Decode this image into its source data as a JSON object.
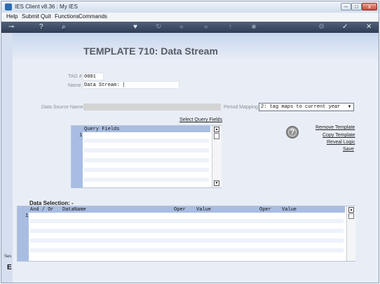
{
  "window": {
    "title": "IES Client v8.36 : My IES",
    "buttons": {
      "minimize": "–",
      "maximize": "□",
      "close": "x"
    }
  },
  "menu": [
    "Help",
    "Submit",
    "Quit",
    "Functions",
    "Commands"
  ],
  "toolbar": {
    "icons": [
      {
        "name": "key-icon",
        "glyph": "⊸"
      },
      {
        "name": "help-circle-icon",
        "glyph": "?"
      },
      {
        "name": "search-icon",
        "glyph": "⌕"
      },
      {
        "name": "heart-icon",
        "glyph": "♥"
      },
      {
        "name": "refresh-icon",
        "glyph": "↻"
      },
      {
        "name": "back-icon",
        "glyph": "«"
      },
      {
        "name": "forward-icon",
        "glyph": "»"
      },
      {
        "name": "up-icon",
        "glyph": "↑"
      },
      {
        "name": "stop-icon",
        "glyph": "■"
      },
      {
        "name": "settings-icon",
        "glyph": "⚙"
      },
      {
        "name": "ok-icon",
        "glyph": "✓"
      },
      {
        "name": "close-icon",
        "glyph": "✕"
      }
    ]
  },
  "sidebar": {
    "label1": "Ses",
    "label2": "E"
  },
  "page": {
    "title": "TEMPLATE 710: Data Stream"
  },
  "form": {
    "tag_label": "TAG #",
    "tag_value": "0001",
    "name_label": "Name",
    "name_value": "Data Stream: |",
    "datasource_label": "Data Source Name",
    "period_label": "Period Mapping",
    "period_value": "2: tag maps to current year"
  },
  "query": {
    "link": "Select Query Fields",
    "header": "Query Fields",
    "row_number": "1"
  },
  "actions": {
    "help_glyph": "?",
    "remove": "Remove Template",
    "copy": "Copy Template",
    "reveal": "Reveal Logic",
    "save": "Save"
  },
  "selection": {
    "title": "Data Selection: -",
    "columns": [
      "And / Or",
      "DataName",
      "Oper",
      "Value",
      "Oper",
      "Value"
    ],
    "row_number": "1"
  },
  "scroll": {
    "up": "▲",
    "down": "▼",
    "dropdown": "▼"
  }
}
